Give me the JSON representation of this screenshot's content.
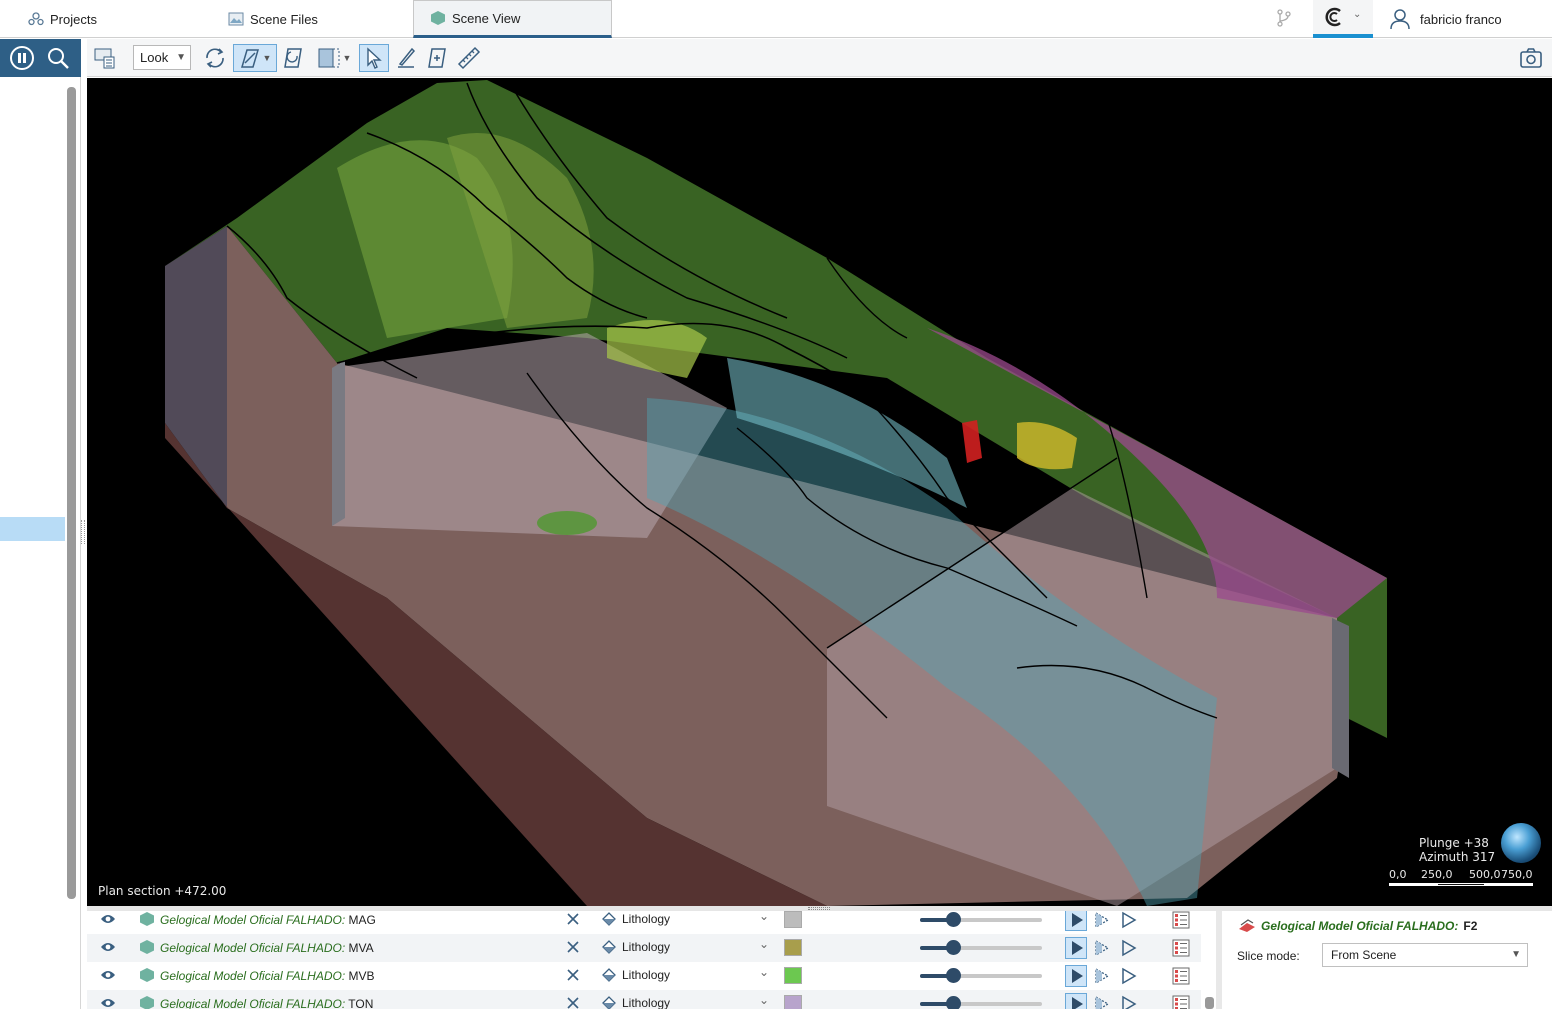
{
  "tabs": [
    {
      "label": "Projects",
      "icon": "projects-icon"
    },
    {
      "label": "Scene Files",
      "icon": "scene-files-icon"
    },
    {
      "label": "Scene View",
      "icon": "scene-view-icon",
      "active": true
    }
  ],
  "user": {
    "name": "fabricio franco",
    "icon": "user-icon"
  },
  "toolbar": {
    "view_mode": "Look",
    "tools": [
      "clear-scene-icon",
      "rotate-icon",
      "draw-section-icon",
      "section-reset-icon",
      "slice-box-icon",
      "select-icon",
      "draw-line-icon",
      "fit-view-icon",
      "ruler-icon",
      "screenshot-icon"
    ]
  },
  "viewport": {
    "plan_section": "Plan section +472.00",
    "plunge": "Plunge +38",
    "azimuth": "Azimuth 317",
    "scale_labels": [
      "0,0",
      "250,0",
      "500,0",
      "750,0"
    ]
  },
  "layers": [
    {
      "model": "Gelogical Model Oficial FALHADO:",
      "unit": " MAG",
      "colouring": "Lithology",
      "swatch": "#bcbcbc"
    },
    {
      "model": "Gelogical Model Oficial FALHADO:",
      "unit": " MVA",
      "colouring": "Lithology",
      "swatch": "#a89e4c"
    },
    {
      "model": "Gelogical Model Oficial FALHADO:",
      "unit": " MVB",
      "colouring": "Lithology",
      "swatch": "#6cc850"
    },
    {
      "model": "Gelogical Model Oficial FALHADO:",
      "unit": " TON",
      "colouring": "Lithology",
      "swatch": "#b8a4cc"
    }
  ],
  "properties": {
    "model": "Gelogical Model Oficial FALHADO:",
    "unit": "F2",
    "slice_mode_label": "Slice mode:",
    "slice_mode_value": "From Scene"
  },
  "colors": {
    "accent": "#2e5f86",
    "selection": "#cfe5f8",
    "model_text": "#2a6e1e"
  }
}
